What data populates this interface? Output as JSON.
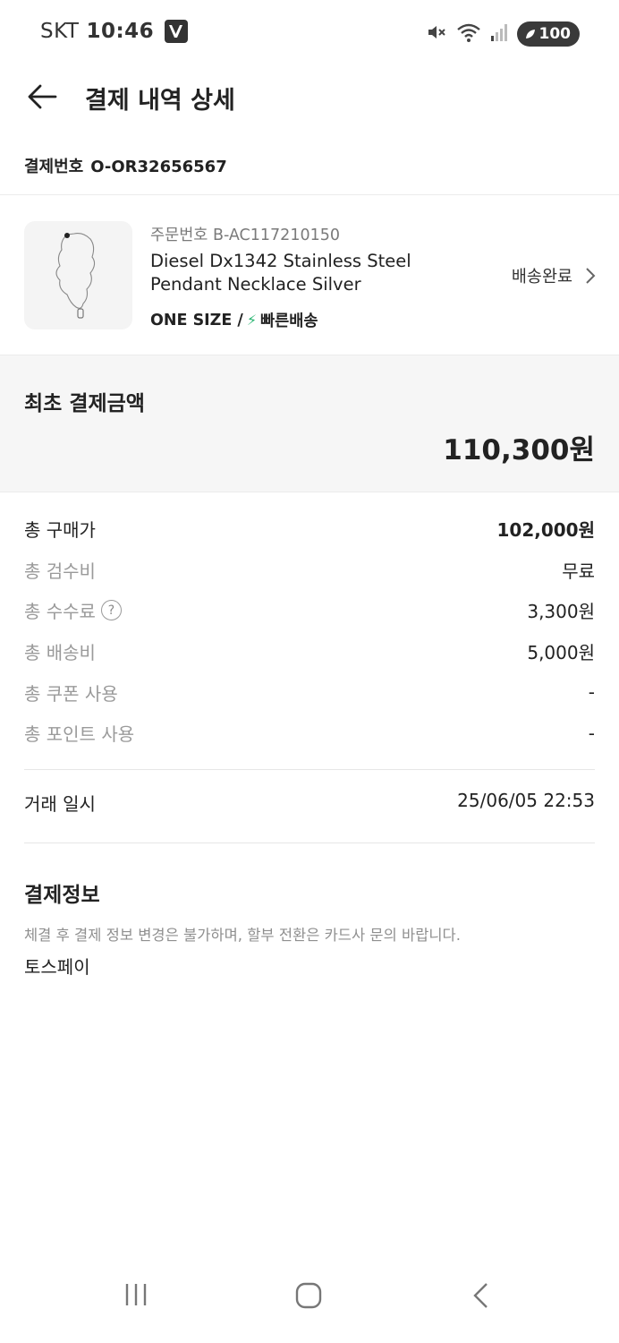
{
  "status_bar": {
    "carrier": "SKT",
    "time": "10:46",
    "battery": "100",
    "icons": [
      "app-v-icon",
      "mute-icon",
      "wifi-icon",
      "signal-icon",
      "battery-icon"
    ]
  },
  "header": {
    "title": "결제 내역 상세"
  },
  "payment_number": {
    "label": "결제번호",
    "value": "O-OR32656567"
  },
  "product": {
    "order_no": "주문번호 B-AC117210150",
    "name": "Diesel Dx1342 Stainless Steel Pendant Necklace Silver",
    "size": "ONE SIZE /",
    "shipping_badge": "빠른배송",
    "status": "배송완료"
  },
  "total": {
    "label": "최초 결제금액",
    "value": "110,300원"
  },
  "breakdown": [
    {
      "label": "총 구매가",
      "value": "102,000원"
    },
    {
      "label": "총 검수비",
      "value": "무료"
    },
    {
      "label": "총 수수료",
      "value": "3,300원"
    },
    {
      "label": "총 배송비",
      "value": "5,000원"
    },
    {
      "label": "총 쿠폰 사용",
      "value": "-"
    },
    {
      "label": "총 포인트 사용",
      "value": "-"
    }
  ],
  "transaction": {
    "label": "거래 일시",
    "value": "25/06/05 22:53"
  },
  "payment_info": {
    "title": "결제정보",
    "note": "체결 후 결제 정보 변경은 불가하며, 할부 전환은 카드사 문의 바랍니다.",
    "method": "토스페이"
  },
  "colors": {
    "accent_green": "#2bb673",
    "text_primary": "#222222",
    "text_muted": "#9a9a9a",
    "box_bg": "#f6f6f6"
  }
}
